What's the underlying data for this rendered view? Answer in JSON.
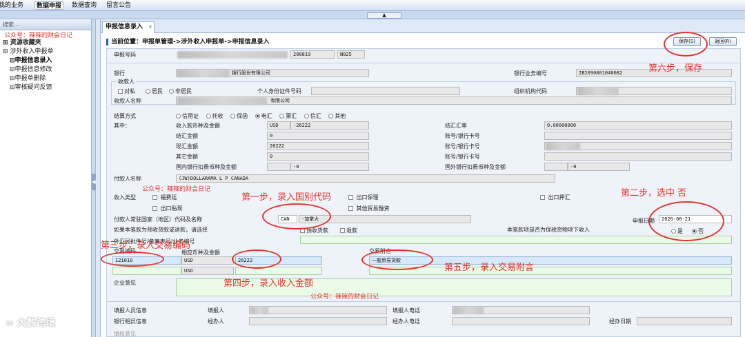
{
  "top_menu": {
    "items": [
      "我的业务",
      "数据申报",
      "数据查询",
      "留言公告"
    ],
    "active_index": 1
  },
  "sidebar": {
    "header": "搜索...",
    "items": [
      {
        "label": "资源收藏夹"
      },
      {
        "label": "涉外收入申报单"
      },
      {
        "label": "申报信息录入"
      },
      {
        "label": "申报信息修改"
      },
      {
        "label": "申报单删除"
      },
      {
        "label": "审核疑问反馈"
      }
    ]
  },
  "tab": {
    "label": "申报信息录入",
    "close": "×"
  },
  "breadcrumb": "当前位置：申报单管理->涉外收入申报单->申报信息录入",
  "buttons": {
    "save": "保存(S)",
    "back": "返回(R)"
  },
  "form": {
    "declaration_no_label": "申报号码",
    "declaration_no_parts": [
      "200819",
      "N025"
    ],
    "bank_label": "银行",
    "bank_value": "银行股份有限公司",
    "bank_biz_no_label": "银行业务编号",
    "bank_biz_no_value": "IB2090801040082",
    "payee_group_label": "收款人",
    "payee_type_options": [
      "对私",
      "居民",
      "非居民"
    ],
    "id_label": "个人身份证件号码",
    "org_code_label": "组织机构代码",
    "payee_name_label": "收款人名称",
    "payee_name_value": "有限公司",
    "settle_label": "结算方式",
    "settle_options": [
      "信用证",
      "托收",
      "保函",
      "电汇",
      "票汇",
      "信汇",
      "其他"
    ],
    "settle_selected": "电汇",
    "among_label": "其中：",
    "amount_label": "收入款币种及金额",
    "amount_currency": "USD",
    "amount_value": "-26222",
    "fx_settle_label": "结汇金额",
    "fx_settle_value": "0",
    "spot_label": "现汇金额",
    "spot_value": "26222",
    "other_label": "其它金额",
    "other_value": "0",
    "domestic_fee_label": "国内银行扣费币种及金额",
    "domestic_fee_value": "-0",
    "fx_rate_label": "结汇汇率",
    "fx_rate_value": "0.00000000",
    "account_label": "账号/银行卡号",
    "foreign_fee_label": "国外银行扣费币种及金额",
    "foreign_fee_value": "-0",
    "payer_label": "付款人名称",
    "payer_value": "(JW)DOLLARAMA L P CANADA",
    "payment_type_label": "收入类型",
    "payment_type_options": [
      "福费廷",
      "出口保理",
      "出口押汇",
      "出口贴现",
      "其他贸易融资"
    ],
    "country_label": "付款人常驻国家（地区）代码及名称",
    "country_code": "CAN",
    "country_name": "-加拿大",
    "declare_date_label": "申报日期",
    "declare_date_value": "2020-08-21",
    "prepay_question": "如果本笔款为预收货款或退款，请选择",
    "prepay_options": [
      "预收货款",
      "退款"
    ],
    "bonded_question": "本笔款项是否为保税货物项下收入",
    "yes_no": [
      "是",
      "否"
    ],
    "yes_no_selected": "否",
    "batch_label": "外汇局批件号/备案表号/业务编号",
    "txn_code_label": "交易编码",
    "txn_code_value": "121010",
    "currency_amount_label": "相应币种及金额",
    "txn_currency": "USD",
    "txn_amount": "26222",
    "txn_currency_2": "USD",
    "txn_note_label": "交易附言",
    "txn_note_value": "一般贸易货款",
    "opinion_label": "企业意见",
    "filler_info_label": "填报人员信息",
    "filler_label": "填报人",
    "filler_phone_label": "填报人电话",
    "bank_staff_label": "银行相员信息",
    "handler_label": "经办人",
    "handler_phone_label": "经办人电话",
    "handle_date_label": "经办日期",
    "review_label": "填核意见"
  },
  "annotations": {
    "wechat_top": "公众号：辣辣的财会日记",
    "wechat_mid": "公众号：辣辣的财会日记",
    "wechat_bottom": "公众号：辣辣的财会日记",
    "step1": "第一步，录入国别代码",
    "step2": "第二步，选中 否",
    "step3": "第三步，录入交易编码",
    "step4": "第四步，录入收入金额",
    "step5": "第五步，录入交易附言",
    "step6": "第六步，保存",
    "accent_color": "#e8332a"
  },
  "watermark": "大数跨境"
}
